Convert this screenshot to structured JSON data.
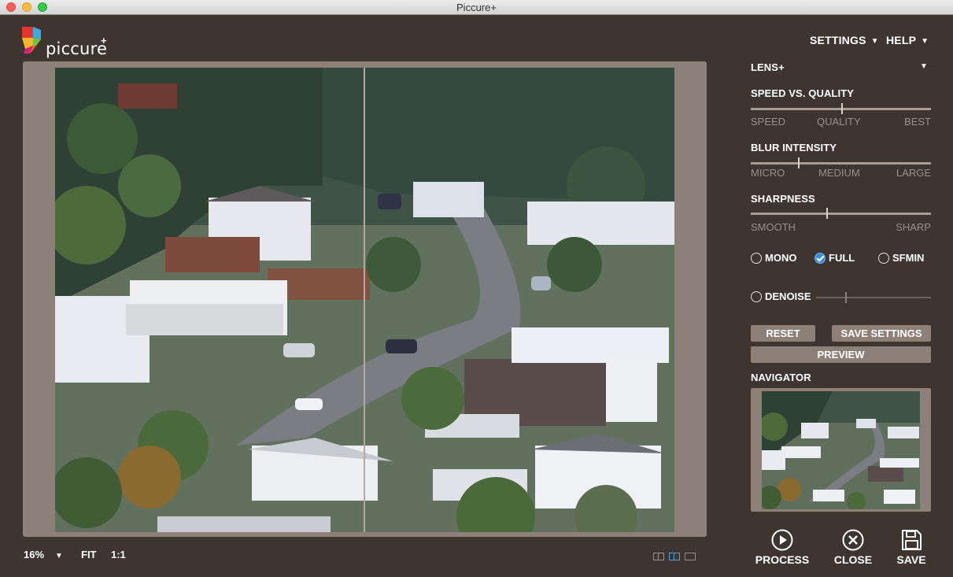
{
  "window": {
    "title": "Piccure+"
  },
  "logo": {
    "word": "piccure",
    "plus": "+"
  },
  "menu": {
    "settings": "SETTINGS",
    "help": "HELP",
    "arrow": "▼"
  },
  "lens": {
    "label": "LENS+",
    "arrow": "▼"
  },
  "speed_quality": {
    "title": "SPEED VS. QUALITY",
    "labels": [
      "SPEED",
      "QUALITY",
      "BEST"
    ],
    "value": 0.5
  },
  "blur_intensity": {
    "title": "BLUR INTENSITY",
    "labels": [
      "MICRO",
      "MEDIUM",
      "LARGE"
    ],
    "value": 0.26
  },
  "sharpness": {
    "title": "SHARPNESS",
    "labels": [
      "SMOOTH",
      "SHARP"
    ],
    "value": 0.42
  },
  "modes": {
    "mono": "MONO",
    "full": "FULL",
    "sfmin": "SFMIN",
    "selected": "FULL"
  },
  "denoise": {
    "label": "DENOISE",
    "value": 0.25,
    "enabled": false
  },
  "buttons": {
    "reset": "RESET",
    "save_settings": "SAVE SETTINGS",
    "preview": "PREVIEW"
  },
  "navigator": {
    "title": "NAVIGATOR"
  },
  "zoom": {
    "level": "16%",
    "arrow": "▼",
    "fit": "FIT",
    "one_to_one": "1:1"
  },
  "view_modes": [
    "split-side-by-side",
    "split-vertical",
    "single"
  ],
  "actions": {
    "process": "PROCESS",
    "close": "CLOSE",
    "save": "SAVE"
  },
  "colors": {
    "background": "#3e3531",
    "frame": "#8c8078",
    "accent": "#3a8fd8"
  }
}
